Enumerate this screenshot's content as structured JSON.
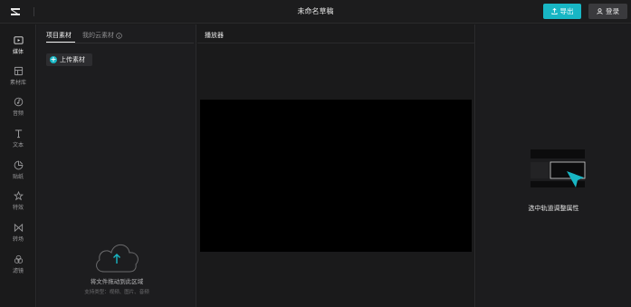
{
  "header": {
    "logo": "capcut-logo-icon",
    "title": "未命名草稿",
    "export_label": "导出",
    "login_label": "登录"
  },
  "sidebar": {
    "items": [
      {
        "label": "媒体",
        "icon": "media-icon"
      },
      {
        "label": "素材库",
        "icon": "library-icon"
      },
      {
        "label": "音频",
        "icon": "audio-icon"
      },
      {
        "label": "文本",
        "icon": "text-icon"
      },
      {
        "label": "贴纸",
        "icon": "sticker-icon"
      },
      {
        "label": "特效",
        "icon": "effects-icon"
      },
      {
        "label": "转场",
        "icon": "transition-icon"
      },
      {
        "label": "滤镜",
        "icon": "filter-icon"
      }
    ]
  },
  "media_panel": {
    "tabs": [
      {
        "label": "项目素材"
      },
      {
        "label": "我的云素材"
      }
    ],
    "upload_label": "上传素材",
    "drop_text": "将文件拖动到此区域",
    "supported_text": "支持类型：视频、图片、音频"
  },
  "player": {
    "title": "播放器"
  },
  "properties": {
    "hint": "选中轨道调整属性"
  },
  "colors": {
    "accent": "#18b6c4",
    "background": "#1a1a1b",
    "video_canvas": "#000000"
  }
}
